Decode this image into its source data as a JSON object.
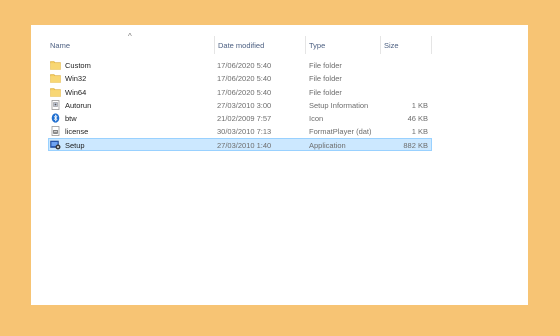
{
  "columns": {
    "name": "Name",
    "date": "Date modified",
    "type": "Type",
    "size": "Size"
  },
  "colors": {
    "background": "#f7c474",
    "selection": "#cce8ff",
    "selection_border": "#99d1ff",
    "folder": "#f4cd5d"
  },
  "files": [
    {
      "name": "Custom",
      "date": "17/06/2020 5:40",
      "type": "File folder",
      "size": "",
      "icon": "folder-icon"
    },
    {
      "name": "Win32",
      "date": "17/06/2020 5:40",
      "type": "File folder",
      "size": "",
      "icon": "folder-icon"
    },
    {
      "name": "Win64",
      "date": "17/06/2020 5:40",
      "type": "File folder",
      "size": "",
      "icon": "folder-icon"
    },
    {
      "name": "Autorun",
      "date": "27/03/2010 3:00",
      "type": "Setup Information",
      "size": "1 KB",
      "icon": "setup-info-icon"
    },
    {
      "name": "btw",
      "date": "21/02/2009 7:57",
      "type": "Icon",
      "size": "46 KB",
      "icon": "bluetooth-icon"
    },
    {
      "name": "license",
      "date": "30/03/2010 7:13",
      "type": "FormatPlayer (dat)",
      "size": "1 KB",
      "icon": "dat-file-icon"
    },
    {
      "name": "Setup",
      "date": "27/03/2010 1:40",
      "type": "Application",
      "size": "882 KB",
      "icon": "setup-app-icon",
      "selected": true
    }
  ]
}
